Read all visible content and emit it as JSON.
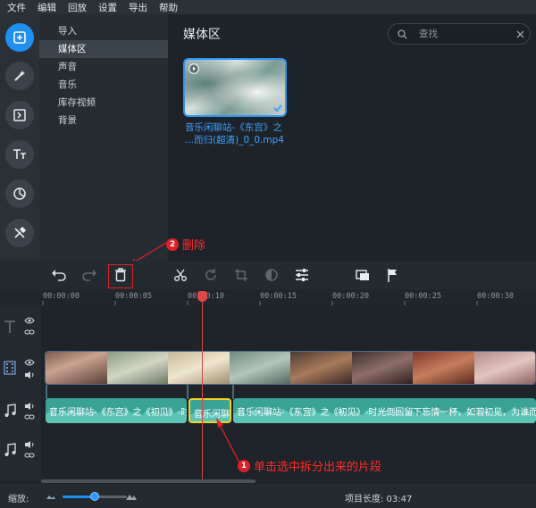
{
  "menu": [
    "文件",
    "编辑",
    "回放",
    "设置",
    "导出",
    "帮助"
  ],
  "categories": [
    {
      "label": "导入",
      "selected": false
    },
    {
      "label": "媒体区",
      "selected": true
    },
    {
      "label": "声音",
      "selected": false
    },
    {
      "label": "音乐",
      "selected": false
    },
    {
      "label": "库存视频",
      "selected": false
    },
    {
      "label": "背景",
      "selected": false
    }
  ],
  "media": {
    "title": "媒体区",
    "search_placeholder": "查找",
    "clip_name_line1": "音乐闲聊站-《东宫》之",
    "clip_name_line2": "...而归(超清)_0_0.mp4"
  },
  "ruler": [
    "00:00:00",
    "00:00:05",
    "00:00:10",
    "00:00:15",
    "00:00:20",
    "00:00:25",
    "00:00:30"
  ],
  "audio_segments": [
    {
      "label": "音乐闲聊站-《东宫》之《初见》-时光"
    },
    {
      "label": "音乐闲聊"
    },
    {
      "label": "音乐闲聊站-《东宫》之《初见》-时光倒回留下忘情一杯，如若初见，为谁而"
    }
  ],
  "annotations": {
    "delete_num": "2",
    "delete_text": "删除",
    "select_num": "1",
    "select_text": "单击选中拆分出来的片段"
  },
  "status": {
    "zoom_label": "缩放:",
    "zoom_level": 0.5,
    "project_length": "项目长度: 03:47"
  },
  "colors": {
    "accent": "#1f8ff0",
    "annotation": "#e31f26",
    "audio": "#3aa398",
    "selected": "#f4d21f"
  }
}
